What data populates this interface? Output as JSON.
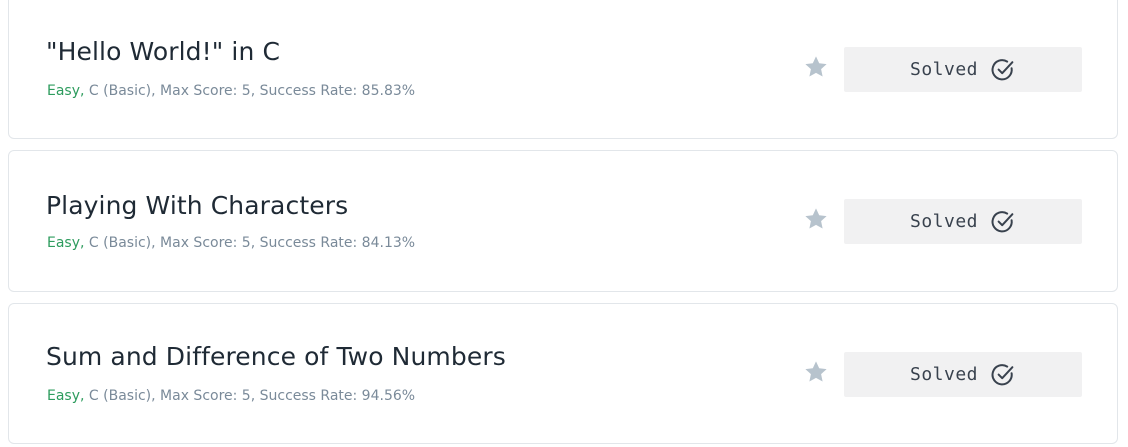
{
  "colors": {
    "title": "#1f2a35",
    "meta": "#7a8a99",
    "difficulty": "#2e9c5e",
    "star": "#b7c3cd",
    "button_bg": "#f1f1f2",
    "button_text": "#39424e"
  },
  "challenges": [
    {
      "title": "\"Hello World!\" in C",
      "difficulty": "Easy,",
      "details": " C (Basic), Max Score: 5, Success Rate: 85.83%",
      "star_icon": "star-icon",
      "status_label": "Solved",
      "status_icon": "check-circle-icon"
    },
    {
      "title": "Playing With Characters",
      "difficulty": "Easy,",
      "details": " C (Basic), Max Score: 5, Success Rate: 84.13%",
      "star_icon": "star-icon",
      "status_label": "Solved",
      "status_icon": "check-circle-icon"
    },
    {
      "title": "Sum and Difference of Two Numbers",
      "difficulty": "Easy,",
      "details": " C (Basic), Max Score: 5, Success Rate: 94.56%",
      "star_icon": "star-icon",
      "status_label": "Solved",
      "status_icon": "check-circle-icon"
    }
  ]
}
